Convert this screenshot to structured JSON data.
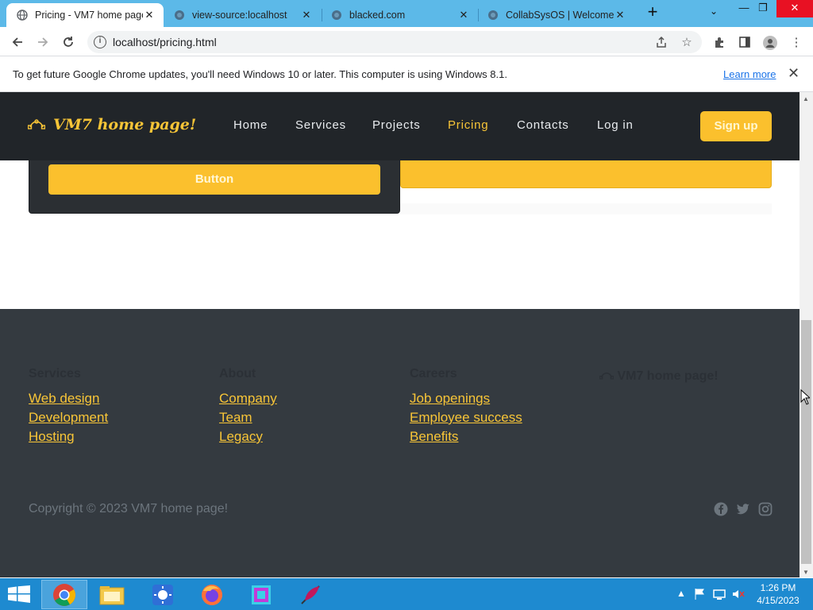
{
  "browser": {
    "tabs": [
      {
        "title": "Pricing - VM7 home page!",
        "active": true
      },
      {
        "title": "view-source:localhost",
        "active": false
      },
      {
        "title": "blacked.com",
        "active": false
      },
      {
        "title": "CollabSysOS | Welcome",
        "active": false
      }
    ],
    "url": "localhost/pricing.html",
    "infobar": {
      "message": "To get future Google Chrome updates, you'll need Windows 10 or later. This computer is using Windows 8.1.",
      "link": "Learn more"
    }
  },
  "site": {
    "brand": "VM7 home page!",
    "nav": [
      {
        "label": "Home",
        "active": false
      },
      {
        "label": "Services",
        "active": false
      },
      {
        "label": "Projects",
        "active": false
      },
      {
        "label": "Pricing",
        "active": true
      },
      {
        "label": "Contacts",
        "active": false
      },
      {
        "label": "Log in",
        "active": false
      }
    ],
    "signup_label": "Sign up",
    "card_button_label": "Button",
    "footer": {
      "columns": [
        {
          "heading": "Services",
          "links": [
            "Web design",
            "Development",
            "Hosting"
          ]
        },
        {
          "heading": "About",
          "links": [
            "Company",
            "Team",
            "Legacy"
          ]
        },
        {
          "heading": "Careers",
          "links": [
            "Job openings",
            "Employee success",
            "Benefits"
          ]
        }
      ],
      "brand": "VM7 home page!",
      "copyright": "Copyright © 2023 VM7 home page!",
      "social_icons": [
        "facebook-icon",
        "twitter-icon",
        "instagram-icon"
      ]
    },
    "colors": {
      "accent": "#f8c537",
      "button": "#fbc02d",
      "nav_bg": "#212529",
      "footer_bg": "#343a40"
    }
  },
  "taskbar": {
    "time": "1:26 PM",
    "date": "4/15/2023"
  }
}
